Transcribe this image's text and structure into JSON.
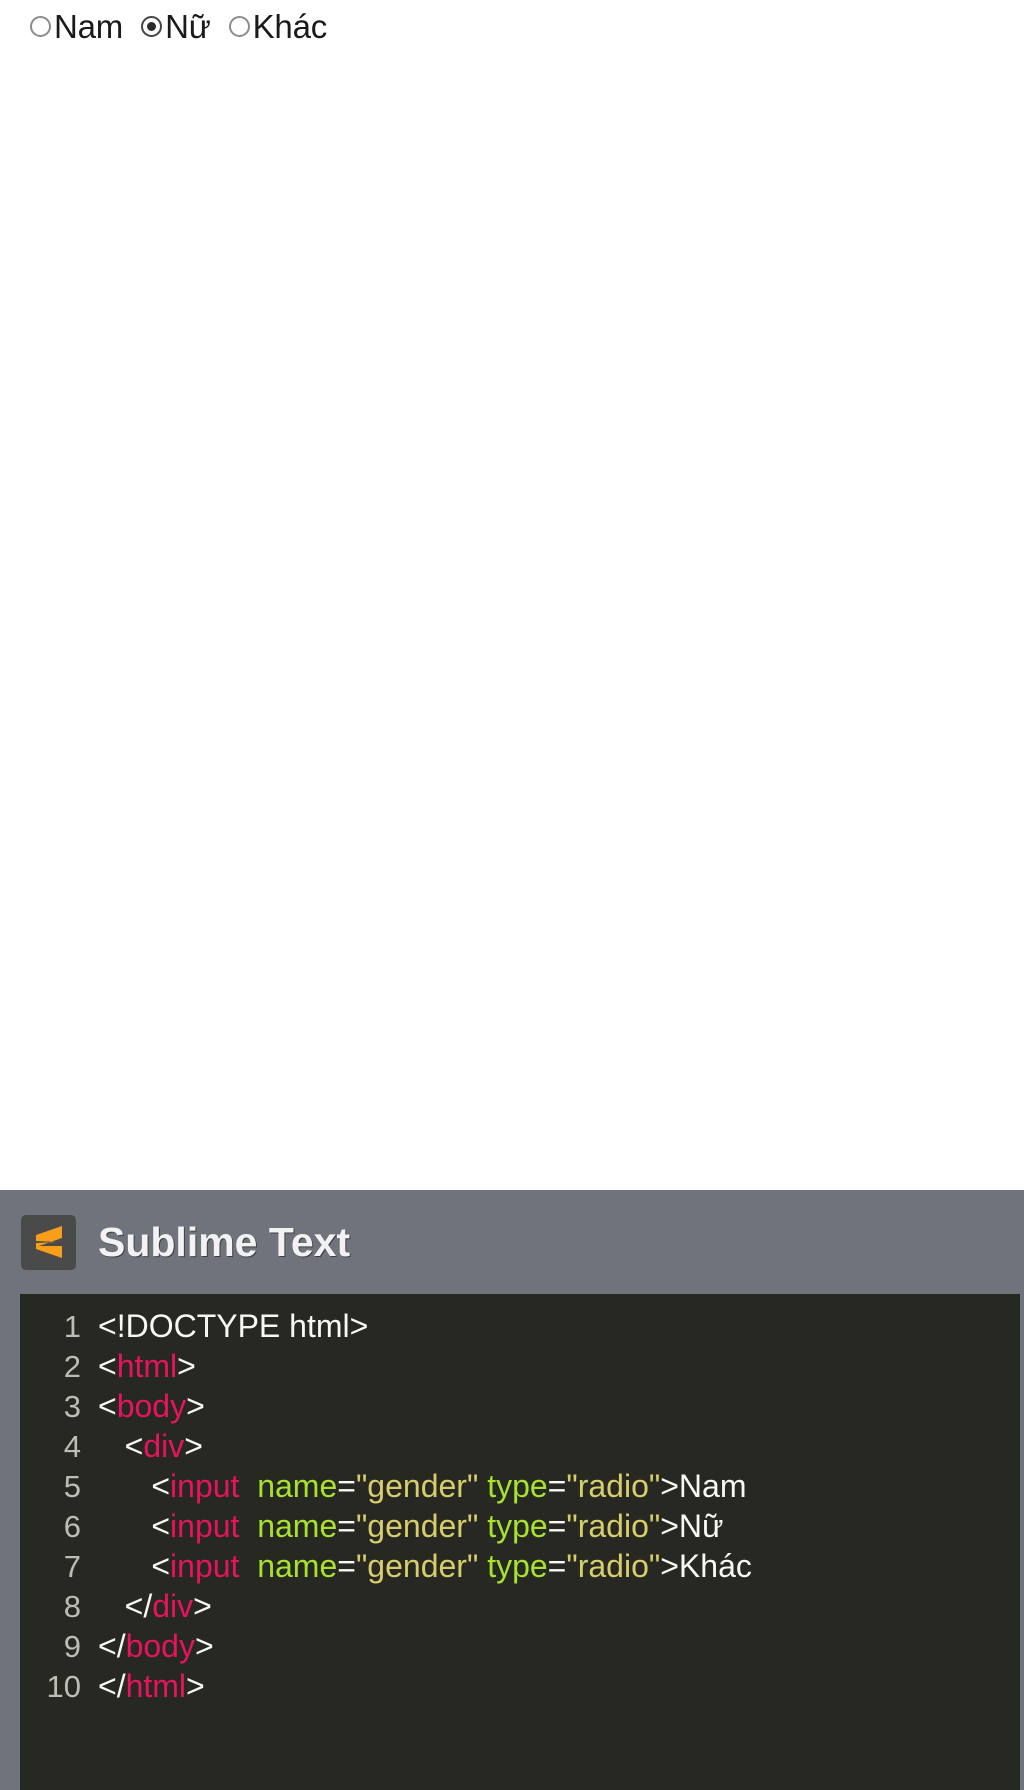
{
  "page": {
    "background_color": "#ffffff"
  },
  "form": {
    "name": "gender-radio-group",
    "options": [
      {
        "label": "Nam",
        "value": "Nam",
        "checked": false
      },
      {
        "label": "Nữ",
        "value": "Nữ",
        "checked": true
      },
      {
        "label": "Khác",
        "value": "Khác",
        "checked": false
      }
    ]
  },
  "editor": {
    "app_name": "Sublime Text",
    "logo_icon": "sublime-text-logo-icon",
    "titlebar_color": "#6f737b",
    "editor_background": "#272822",
    "gutter_text_color": "#bdbdb6",
    "syntax_colors": {
      "tag": "#e6145f",
      "attribute": "#a6e22e",
      "value": "#d7cd6b",
      "punctuation": "#f8f8f2",
      "text": "#f8f8f2"
    },
    "lines": [
      {
        "number": "1",
        "tokens": [
          {
            "t": "plain",
            "s": "<!DOCTYPE html>"
          }
        ]
      },
      {
        "number": "2",
        "tokens": [
          {
            "t": "punct",
            "s": "<"
          },
          {
            "t": "tag",
            "s": "html"
          },
          {
            "t": "punct",
            "s": ">"
          }
        ]
      },
      {
        "number": "3",
        "tokens": [
          {
            "t": "punct",
            "s": "<"
          },
          {
            "t": "tag",
            "s": "body"
          },
          {
            "t": "punct",
            "s": ">"
          }
        ]
      },
      {
        "number": "4",
        "tokens": [
          {
            "t": "plain",
            "s": "   "
          },
          {
            "t": "punct",
            "s": "<"
          },
          {
            "t": "tag",
            "s": "div"
          },
          {
            "t": "punct",
            "s": ">"
          }
        ]
      },
      {
        "number": "5",
        "tokens": [
          {
            "t": "plain",
            "s": "      "
          },
          {
            "t": "punct",
            "s": "<"
          },
          {
            "t": "tag",
            "s": "input"
          },
          {
            "t": "plain",
            "s": "  "
          },
          {
            "t": "attr",
            "s": "name"
          },
          {
            "t": "punct",
            "s": "="
          },
          {
            "t": "val",
            "s": "\"gender\""
          },
          {
            "t": "plain",
            "s": " "
          },
          {
            "t": "attr",
            "s": "type"
          },
          {
            "t": "punct",
            "s": "="
          },
          {
            "t": "val",
            "s": "\"radio\""
          },
          {
            "t": "punct",
            "s": ">"
          },
          {
            "t": "plain",
            "s": "Nam"
          }
        ]
      },
      {
        "number": "6",
        "tokens": [
          {
            "t": "plain",
            "s": "      "
          },
          {
            "t": "punct",
            "s": "<"
          },
          {
            "t": "tag",
            "s": "input"
          },
          {
            "t": "plain",
            "s": "  "
          },
          {
            "t": "attr",
            "s": "name"
          },
          {
            "t": "punct",
            "s": "="
          },
          {
            "t": "val",
            "s": "\"gender\""
          },
          {
            "t": "plain",
            "s": " "
          },
          {
            "t": "attr",
            "s": "type"
          },
          {
            "t": "punct",
            "s": "="
          },
          {
            "t": "val",
            "s": "\"radio\""
          },
          {
            "t": "punct",
            "s": ">"
          },
          {
            "t": "plain",
            "s": "Nữ"
          }
        ]
      },
      {
        "number": "7",
        "tokens": [
          {
            "t": "plain",
            "s": "      "
          },
          {
            "t": "punct",
            "s": "<"
          },
          {
            "t": "tag",
            "s": "input"
          },
          {
            "t": "plain",
            "s": "  "
          },
          {
            "t": "attr",
            "s": "name"
          },
          {
            "t": "punct",
            "s": "="
          },
          {
            "t": "val",
            "s": "\"gender\""
          },
          {
            "t": "plain",
            "s": " "
          },
          {
            "t": "attr",
            "s": "type"
          },
          {
            "t": "punct",
            "s": "="
          },
          {
            "t": "val",
            "s": "\"radio\""
          },
          {
            "t": "punct",
            "s": ">"
          },
          {
            "t": "plain",
            "s": "Khác"
          }
        ]
      },
      {
        "number": "8",
        "tokens": [
          {
            "t": "plain",
            "s": "   "
          },
          {
            "t": "punct",
            "s": "</"
          },
          {
            "t": "tag",
            "s": "div"
          },
          {
            "t": "punct",
            "s": ">"
          }
        ]
      },
      {
        "number": "9",
        "tokens": [
          {
            "t": "punct",
            "s": "</"
          },
          {
            "t": "tag",
            "s": "body"
          },
          {
            "t": "punct",
            "s": ">"
          }
        ]
      },
      {
        "number": "10",
        "tokens": [
          {
            "t": "punct",
            "s": "</"
          },
          {
            "t": "tag",
            "s": "html"
          },
          {
            "t": "punct",
            "s": ">"
          }
        ]
      }
    ]
  }
}
